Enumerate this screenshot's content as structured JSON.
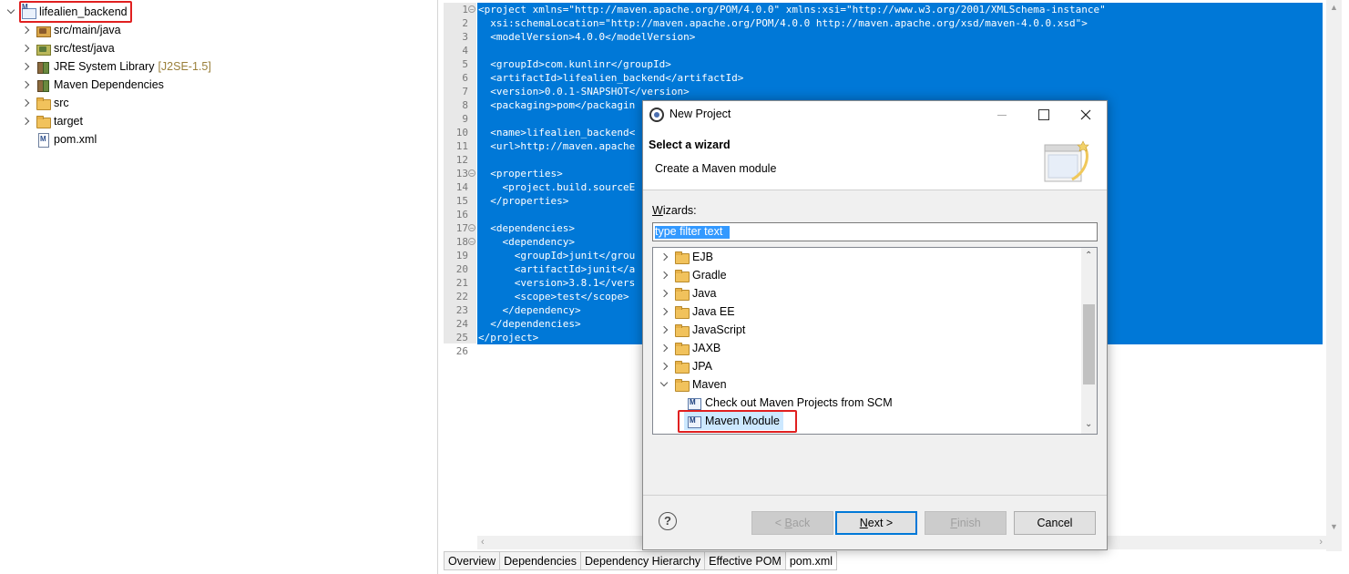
{
  "explorer": {
    "project": {
      "label": "lifealien_backend"
    },
    "items": [
      {
        "label": "src/main/java",
        "decoration": ""
      },
      {
        "label": "src/test/java",
        "decoration": ""
      },
      {
        "label": "JRE System Library",
        "decoration": "[J2SE-1.5]"
      },
      {
        "label": "Maven Dependencies",
        "decoration": ""
      },
      {
        "label": "src",
        "decoration": ""
      },
      {
        "label": "target",
        "decoration": ""
      },
      {
        "label": "pom.xml",
        "decoration": ""
      }
    ]
  },
  "editor": {
    "lines": [
      {
        "n": "1",
        "text": "<project xmlns=\"http://maven.apache.org/POM/4.0.0\" xmlns:xsi=\"http://www.w3.org/2001/XMLSchema-instance\""
      },
      {
        "n": "2",
        "text": "  xsi:schemaLocation=\"http://maven.apache.org/POM/4.0.0 http://maven.apache.org/xsd/maven-4.0.0.xsd\">"
      },
      {
        "n": "3",
        "text": "  <modelVersion>4.0.0</modelVersion>"
      },
      {
        "n": "4",
        "text": ""
      },
      {
        "n": "5",
        "text": "  <groupId>com.kunlinr</groupId>"
      },
      {
        "n": "6",
        "text": "  <artifactId>lifealien_backend</artifactId>"
      },
      {
        "n": "7",
        "text": "  <version>0.0.1-SNAPSHOT</version>"
      },
      {
        "n": "8",
        "text": "  <packaging>pom</packagin"
      },
      {
        "n": "9",
        "text": ""
      },
      {
        "n": "10",
        "text": "  <name>lifealien_backend<"
      },
      {
        "n": "11",
        "text": "  <url>http://maven.apache"
      },
      {
        "n": "12",
        "text": ""
      },
      {
        "n": "13",
        "text": "  <properties>"
      },
      {
        "n": "14",
        "text": "    <project.build.sourceE"
      },
      {
        "n": "15",
        "text": "  </properties>"
      },
      {
        "n": "16",
        "text": ""
      },
      {
        "n": "17",
        "text": "  <dependencies>"
      },
      {
        "n": "18",
        "text": "    <dependency>"
      },
      {
        "n": "19",
        "text": "      <groupId>junit</grou"
      },
      {
        "n": "20",
        "text": "      <artifactId>junit</a"
      },
      {
        "n": "21",
        "text": "      <version>3.8.1</vers"
      },
      {
        "n": "22",
        "text": "      <scope>test</scope>"
      },
      {
        "n": "23",
        "text": "    </dependency>"
      },
      {
        "n": "24",
        "text": "  </dependencies>"
      },
      {
        "n": "25",
        "text": "</project>"
      },
      {
        "n": "26",
        "text": ""
      }
    ],
    "tabs": [
      "Overview",
      "Dependencies",
      "Dependency Hierarchy",
      "Effective POM",
      "pom.xml"
    ]
  },
  "dialog": {
    "title": "New Project",
    "banner_title": "Select a wizard",
    "banner_desc": "Create a Maven module",
    "wizards_label_u": "W",
    "wizards_label_rest": "izards:",
    "filter_placeholder": "type filter text",
    "tree": [
      {
        "label": "EJB"
      },
      {
        "label": "Gradle"
      },
      {
        "label": "Java"
      },
      {
        "label": "Java EE"
      },
      {
        "label": "JavaScript"
      },
      {
        "label": "JAXB"
      },
      {
        "label": "JPA"
      },
      {
        "label": "Maven"
      },
      {
        "label": "Check out Maven Projects from SCM"
      },
      {
        "label": "Maven Module"
      }
    ],
    "buttons": {
      "back_pre": "< ",
      "back_u": "B",
      "back_post": "ack",
      "next_u": "N",
      "next_post": "ext >",
      "finish_u": "F",
      "finish_post": "inish",
      "cancel": "Cancel"
    },
    "help_glyph": "?"
  },
  "colors": {
    "selection": "#0078d7",
    "highlight_box": "#e02020",
    "tree_select": "#cce8ff"
  }
}
